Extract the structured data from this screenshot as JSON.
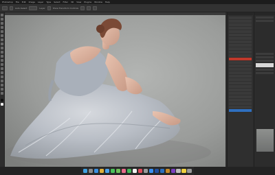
{
  "menubar": {
    "items": [
      "Photoshop",
      "File",
      "Edit",
      "Image",
      "Layer",
      "Type",
      "Select",
      "Filter",
      "3D",
      "View",
      "Plugins",
      "Window",
      "Help"
    ]
  },
  "optionsbar": {
    "labels": [
      "Auto-Select",
      "Layer",
      "Show Transform Controls"
    ]
  },
  "document": {
    "title": ""
  },
  "layers_panel": {
    "rows": [
      "",
      "",
      "",
      "",
      "",
      "",
      "",
      "",
      "",
      "",
      "",
      "",
      "",
      "",
      "",
      "",
      "",
      "",
      "",
      "",
      "",
      "",
      "",
      "",
      "",
      "",
      "",
      "",
      "",
      ""
    ],
    "selected_red_index": 12,
    "selected_blue_index": 27
  },
  "colors": {
    "accent_red": "#c0392b",
    "accent_blue": "#2f6fbf",
    "ui_dark": "#2b2b2b"
  },
  "dock": {
    "icons": [
      "finder-icon",
      "launchpad-icon",
      "safari-icon",
      "chrome-icon",
      "mail-icon",
      "messages-icon",
      "maps-icon",
      "photos-icon",
      "facetime-icon",
      "calendar-icon",
      "music-icon",
      "settings-icon",
      "app-store-icon",
      "photoshop-icon",
      "lightroom-icon",
      "bridge-icon",
      "premiere-icon",
      "preview-icon",
      "notes-icon",
      "trash-icon"
    ],
    "icon_colors": [
      "#3fa0e0",
      "#8a8a8a",
      "#3b8fe0",
      "#e0b03b",
      "#4aa0e8",
      "#49c05a",
      "#6fbf5a",
      "#e86a8a",
      "#45b85a",
      "#f2f2f2",
      "#e04a5a",
      "#9a9a9a",
      "#3a8ff0",
      "#1f4fa0",
      "#2b6fc0",
      "#c58a2a",
      "#7a3fc0",
      "#bdbdbd",
      "#f0d040",
      "#9a9a9a"
    ]
  }
}
